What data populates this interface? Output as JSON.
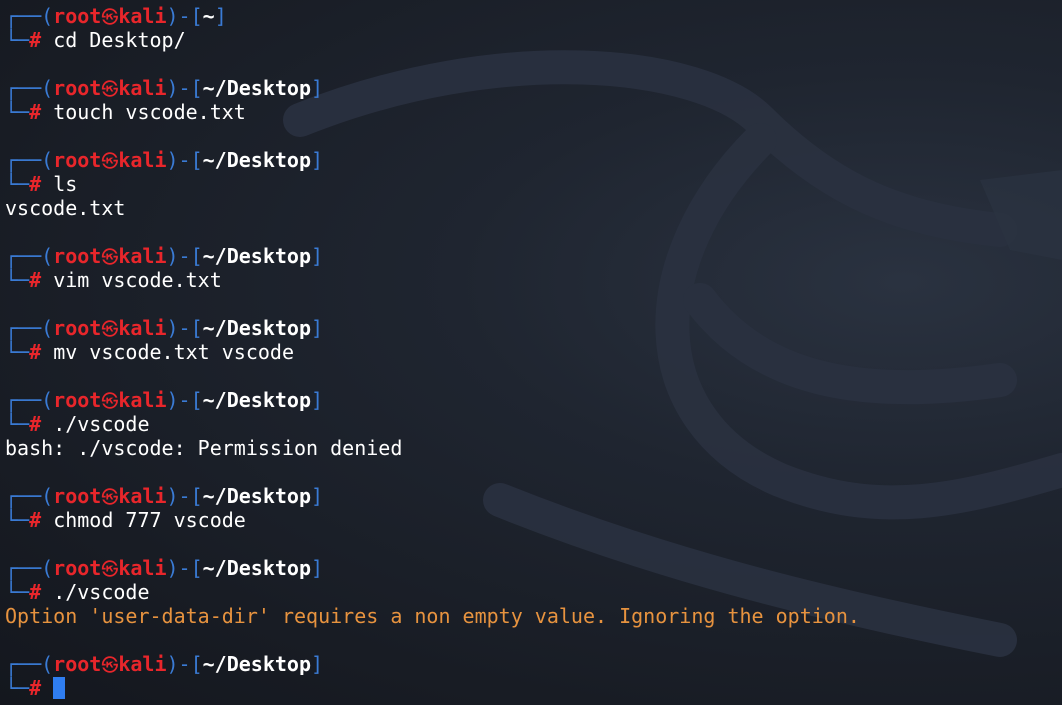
{
  "prompt": {
    "user": "root",
    "host": "kali",
    "skull_glyph": "㉿",
    "hash": "#"
  },
  "entries": [
    {
      "path": "~",
      "command": "cd Desktop/",
      "output": "",
      "output_type": ""
    },
    {
      "path": "~/Desktop",
      "command": "touch vscode.txt",
      "output": "",
      "output_type": ""
    },
    {
      "path": "~/Desktop",
      "command": "ls",
      "output": "vscode.txt",
      "output_type": "normal"
    },
    {
      "path": "~/Desktop",
      "command": "vim vscode.txt",
      "output": "",
      "output_type": ""
    },
    {
      "path": "~/Desktop",
      "command": "mv vscode.txt vscode",
      "output": "",
      "output_type": ""
    },
    {
      "path": "~/Desktop",
      "command": "./vscode",
      "output": "bash: ./vscode: Permission denied",
      "output_type": "normal"
    },
    {
      "path": "~/Desktop",
      "command": "chmod 777 vscode",
      "output": "",
      "output_type": ""
    },
    {
      "path": "~/Desktop",
      "command": "./vscode",
      "output": "Option 'user-data-dir' requires a non empty value. Ignoring the option.",
      "output_type": "warning"
    },
    {
      "path": "~/Desktop",
      "command": "",
      "output": "",
      "output_type": "",
      "active": true
    }
  ],
  "colors": {
    "prompt_red": "#e8262b",
    "box_blue": "#3a7bd5",
    "warning_orange": "#e7933f",
    "cursor_blue": "#2f7df0",
    "background": "#1b2029"
  }
}
